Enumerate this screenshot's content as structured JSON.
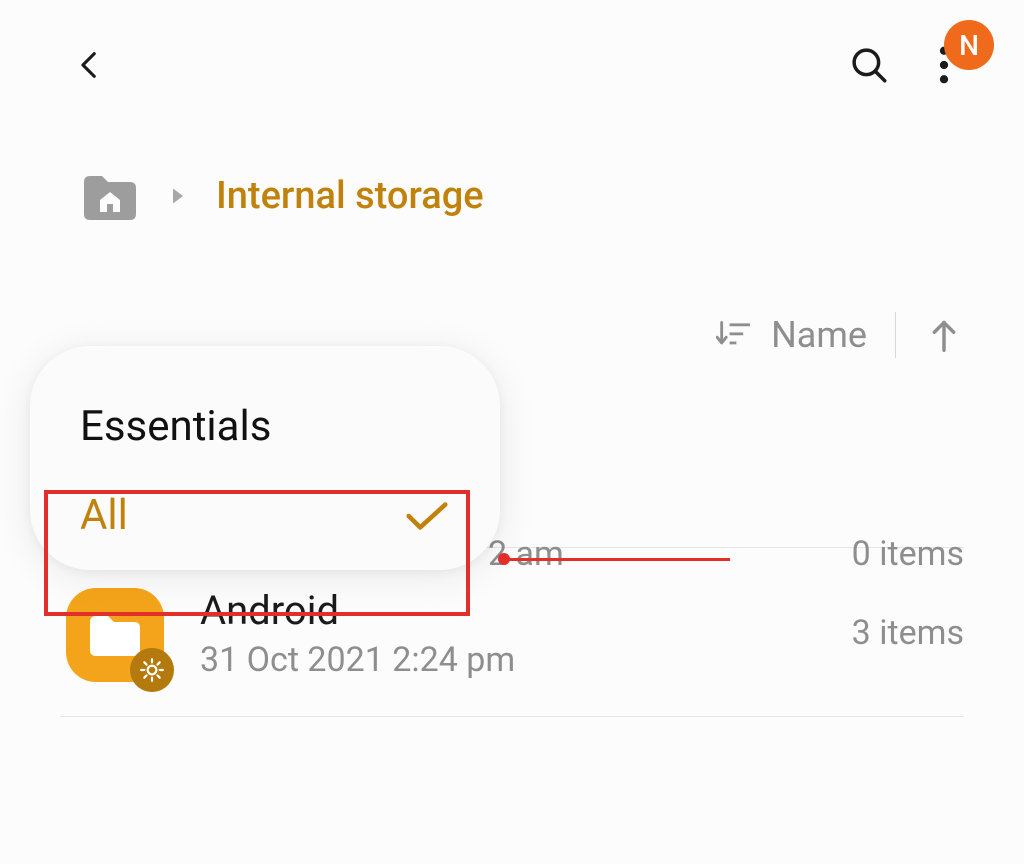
{
  "header": {
    "avatar_initial": "N"
  },
  "breadcrumb": {
    "current": "Internal storage"
  },
  "sort": {
    "label": "Name"
  },
  "filter_menu": {
    "title": "Essentials",
    "selected": "All"
  },
  "rows": [
    {
      "title_hidden": "",
      "time_fragment": "2 am",
      "count": "0 items"
    },
    {
      "title": "Android",
      "subtitle": "31 Oct 2021 2:24 pm",
      "count": "3 items"
    }
  ]
}
